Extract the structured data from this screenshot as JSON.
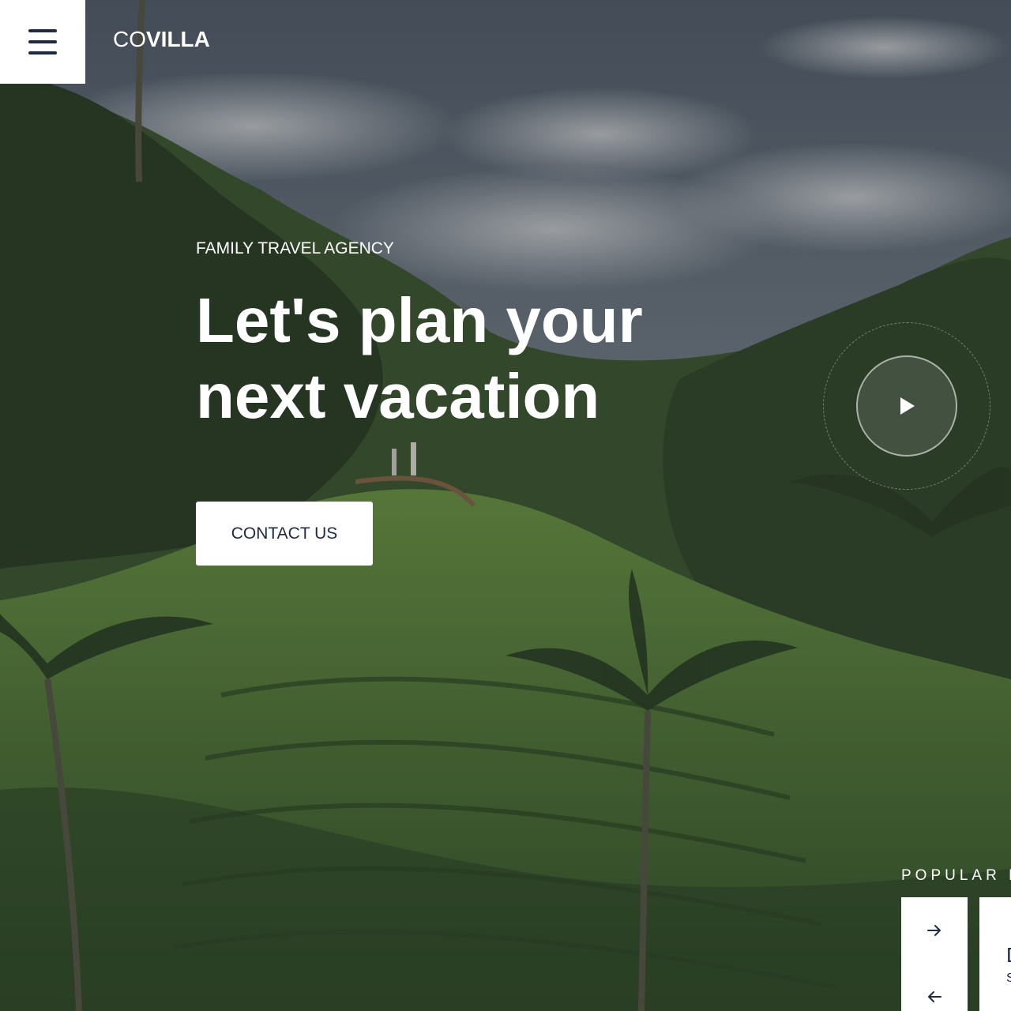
{
  "header": {
    "brand_light": "CO",
    "brand_bold": "VILLA",
    "menu_icon": "hamburger-menu-icon"
  },
  "hero": {
    "kicker": "FAMILY TRAVEL AGENCY",
    "headline_line1": "Let's plan your",
    "headline_line2": "next vacation",
    "cta_label": "CONTACT US",
    "play_icon": "play-icon"
  },
  "popular": {
    "label": "POPULAR L",
    "next_icon": "arrow-right-icon",
    "prev_icon": "arrow-left-icon",
    "card_title_partial": "D",
    "card_sub_partial": "S"
  },
  "colors": {
    "navy": "#1e2a44",
    "white": "#ffffff"
  }
}
